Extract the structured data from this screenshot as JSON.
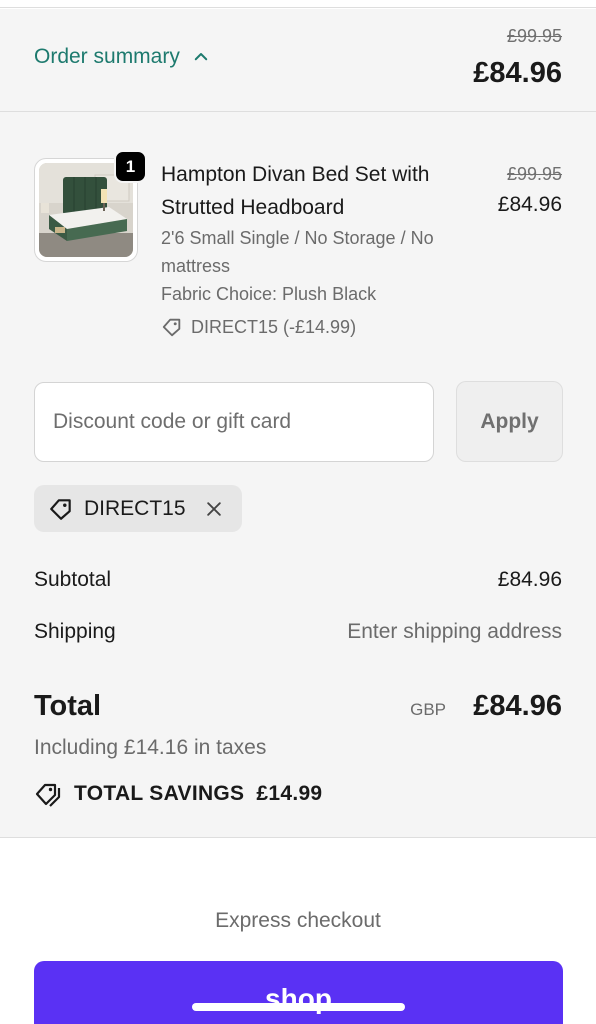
{
  "summary": {
    "toggle_label": "Order summary",
    "original_price": "£99.95",
    "price": "£84.96"
  },
  "line_item": {
    "quantity": "1",
    "title": "Hampton Divan Bed Set with Strutted Headboard",
    "variant": "2'6 Small Single / No Storage / No mattress",
    "fabric": "Fabric Choice: Plush Black",
    "discount": "DIRECT15 (-£14.99)",
    "original_price": "£99.95",
    "price": "£84.96"
  },
  "discount_form": {
    "placeholder": "Discount code or gift card",
    "apply_label": "Apply"
  },
  "applied_code": "DIRECT15",
  "totals": {
    "subtotal_label": "Subtotal",
    "subtotal_value": "£84.96",
    "shipping_label": "Shipping",
    "shipping_value": "Enter shipping address",
    "total_label": "Total",
    "currency": "GBP",
    "total_value": "£84.96",
    "taxes_note": "Including £14.16 in taxes",
    "savings_label": "TOTAL SAVINGS",
    "savings_value": "£14.99"
  },
  "express": {
    "label": "Express checkout",
    "shop_pay_label": "shop"
  },
  "colors": {
    "accent": "#1d7a6e",
    "shop_pay": "#5a31f4",
    "panel_bg": "#f5f5f5"
  },
  "icons": {
    "toggle": "chevron-up-icon",
    "discount": "tag-icon",
    "remove": "close-icon",
    "savings": "tags-icon"
  }
}
